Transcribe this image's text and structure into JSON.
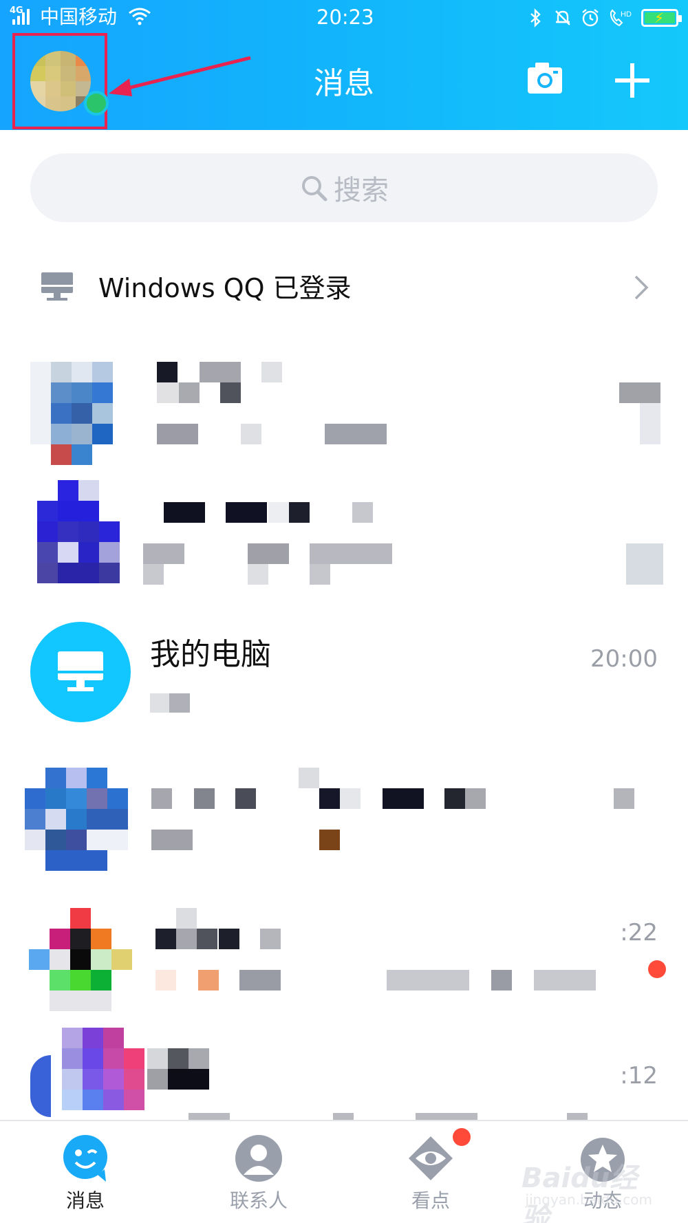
{
  "status_bar": {
    "network": "4G",
    "carrier": "中国移动",
    "time": "20:23",
    "hd_label": "HD"
  },
  "header": {
    "title": "消息",
    "icons": [
      "camera-icon",
      "plus-icon"
    ]
  },
  "search": {
    "placeholder": "搜索"
  },
  "device_banner": {
    "text": "Windows QQ 已登录"
  },
  "conversations": [
    {
      "name": "",
      "time": "",
      "blurred": true
    },
    {
      "name": "",
      "time": "",
      "blurred": true
    },
    {
      "name": "我的电脑",
      "time": "20:00",
      "blurred": false
    },
    {
      "name": "",
      "time": "",
      "blurred": true
    },
    {
      "name": "",
      "time": ":22",
      "blurred": true,
      "unread_dot": true
    },
    {
      "name": "",
      "time": ":12",
      "blurred": true
    }
  ],
  "tabs": [
    {
      "label": "消息",
      "icon": "message-icon",
      "active": true
    },
    {
      "label": "联系人",
      "icon": "contacts-icon",
      "active": false
    },
    {
      "label": "看点",
      "icon": "watch-icon",
      "active": false,
      "badge": true
    },
    {
      "label": "动态",
      "icon": "star-icon",
      "active": false
    }
  ],
  "watermark": {
    "main": "Baidu经验",
    "sub": "jingyan.baidu.com"
  },
  "colors": {
    "header_gradient_start": "#15a4ff",
    "header_gradient_end": "#14c8fb",
    "highlight_box": "#e8234f",
    "arrow": "#e8234f",
    "online": "#2cc46a",
    "my_pc_avatar": "#12c6ff",
    "unread": "#ff4a3a"
  }
}
